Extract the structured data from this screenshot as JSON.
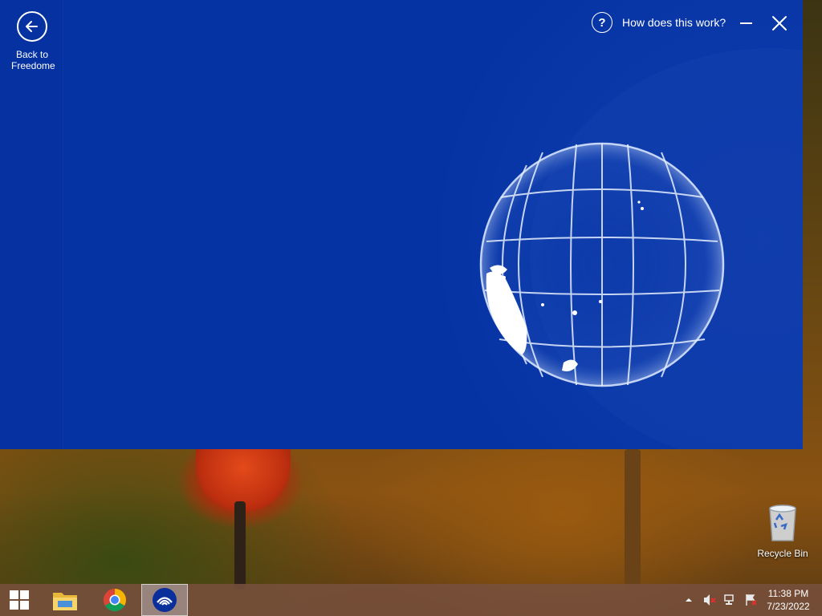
{
  "app": {
    "back_label_line1": "Back to",
    "back_label_line2": "Freedome",
    "help_text": "How does this work?",
    "accent": "#0533a4"
  },
  "desktop": {
    "recycle_bin_label": "Recycle Bin"
  },
  "taskbar": {
    "apps": [
      {
        "name": "File Explorer",
        "icon": "folder-icon"
      },
      {
        "name": "Google Chrome",
        "icon": "chrome-icon"
      },
      {
        "name": "Freedome",
        "icon": "freedome-icon",
        "active": true
      }
    ],
    "tray_icons": [
      "chevron-up-icon",
      "volume-muted-icon",
      "network-icon",
      "action-center-flag-icon"
    ],
    "time": "11:38 PM",
    "date": "7/23/2022"
  }
}
